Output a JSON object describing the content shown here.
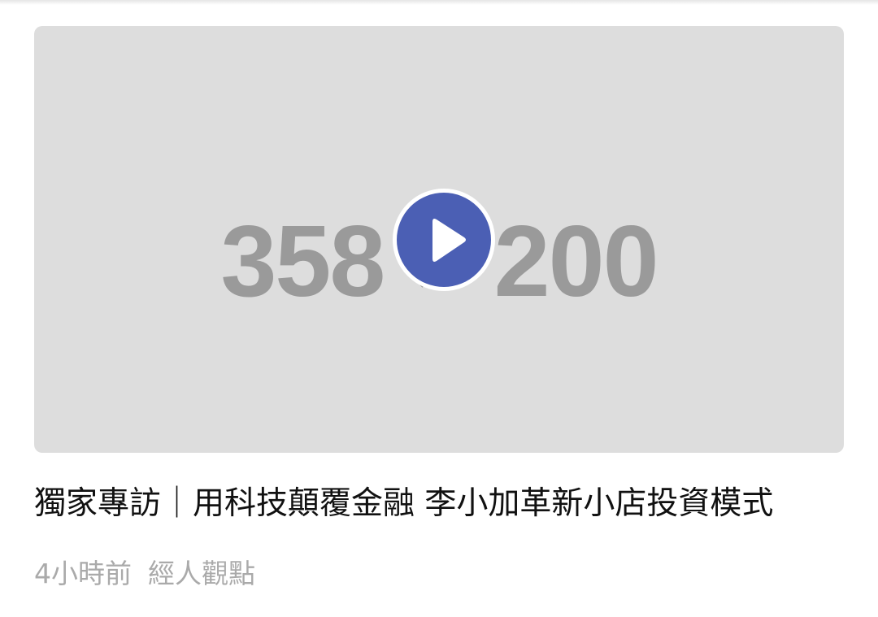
{
  "video": {
    "placeholder_text": "358 × 200",
    "play_icon": "play-icon",
    "accent_color": "#4b5fb4"
  },
  "article": {
    "title": "獨家專訪｜用科技顛覆金融 李小加革新小店投資模式",
    "time_ago": "4小時前",
    "category": "經人觀點"
  }
}
